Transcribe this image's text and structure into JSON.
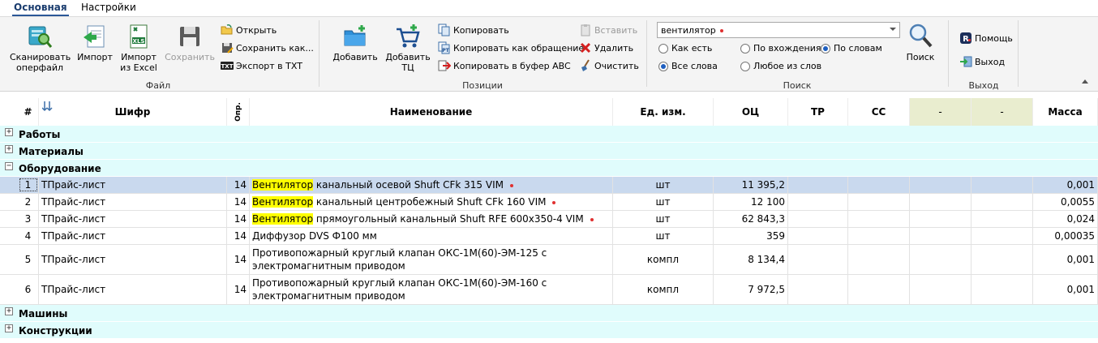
{
  "tabs": [
    {
      "label": "Основная",
      "active": true
    },
    {
      "label": "Настройки",
      "active": false
    }
  ],
  "ribbon": {
    "file": {
      "group_label": "Файл",
      "scan": "Сканировать опер­файл",
      "scan_l1": "Сканировать",
      "scan_l2": "оперфайл",
      "import": "Импорт",
      "import_excel_l1": "Импорт",
      "import_excel_l2": "из Excel",
      "save": "Сохранить",
      "open": "Открыть",
      "save_as": "Сохранить как...",
      "export_txt": "Экспорт в TXT"
    },
    "positions": {
      "group_label": "Позиции",
      "add": "Добавить",
      "add_tc_l1": "Добавить",
      "add_tc_l2": "ТЦ",
      "copy": "Копировать",
      "copy_as_ref": "Копировать как обращение",
      "copy_abc": "Копировать в буфер ABC",
      "paste": "Вставить",
      "delete": "Удалить",
      "clear": "Очистить"
    },
    "search": {
      "group_label": "Поиск",
      "query": "вентилятор",
      "find": "Поиск",
      "opt_as_is": "Как есть",
      "opt_contains": "По вхождениям",
      "opt_words": "По словам",
      "opt_all_words": "Все слова",
      "opt_any_word": "Любое из слов"
    },
    "exit": {
      "group_label": "Выход",
      "help": "Помощь",
      "exit": "Выход"
    }
  },
  "grid": {
    "columns": {
      "num": "#",
      "code": "Шифр",
      "opr": "Опр.",
      "name": "Наименование",
      "unit": "Ед. изм.",
      "oc": "ОЦ",
      "tr": "ТР",
      "cc": "СС",
      "d1": "-",
      "d2": "-",
      "mass": "Масса"
    },
    "groups_top": [
      "Работы",
      "Материалы",
      "Оборудование"
    ],
    "groups_bottom": [
      "Машины",
      "Конструкции"
    ],
    "rows": [
      {
        "num": "1",
        "code": "ТПрайс-лист",
        "opr": "14",
        "hl": "Вентилятор",
        "rest": " канальный осевой Shuft CFk 315 VIM",
        "unit": "шт",
        "oc": "11 395,2",
        "mass": "0,001"
      },
      {
        "num": "2",
        "code": "ТПрайс-лист",
        "opr": "14",
        "hl": "Вентилятор",
        "rest": " канальный центробежный Shuft CFk 160 VIM",
        "unit": "шт",
        "oc": "12 100",
        "mass": "0,0055"
      },
      {
        "num": "3",
        "code": "ТПрайс-лист",
        "opr": "14",
        "hl": "Вентилятор",
        "rest": " прямоугольный канальный Shuft RFE 600x350-4 VIM",
        "unit": "шт",
        "oc": "62 843,3",
        "mass": "0,024"
      },
      {
        "num": "4",
        "code": "ТПрайс-лист",
        "opr": "14",
        "hl": "",
        "rest": "Диффузор DVS Ф100 мм",
        "unit": "шт",
        "oc": "359",
        "mass": "0,00035"
      },
      {
        "num": "5",
        "code": "ТПрайс-лист",
        "opr": "14",
        "hl": "",
        "rest": "Противопожарный круглый клапан ОКС-1М(60)-ЭМ-125 с электромагнитным приводом",
        "unit": "компл",
        "oc": "8 134,4",
        "mass": "0,001"
      },
      {
        "num": "6",
        "code": "ТПрайс-лист",
        "opr": "14",
        "hl": "",
        "rest": "Противопожарный круглый клапан ОКС-1М(60)-ЭМ-160 с электромагнитным приводом",
        "unit": "компл",
        "oc": "7 972,5",
        "mass": "0,001"
      }
    ]
  },
  "colors": {
    "accent": "#2b5797",
    "group_row_bg": "#e0fcfc",
    "selected_row_bg": "#c9d9ee",
    "highlight": "#ffff00",
    "marker": "#e03030"
  }
}
